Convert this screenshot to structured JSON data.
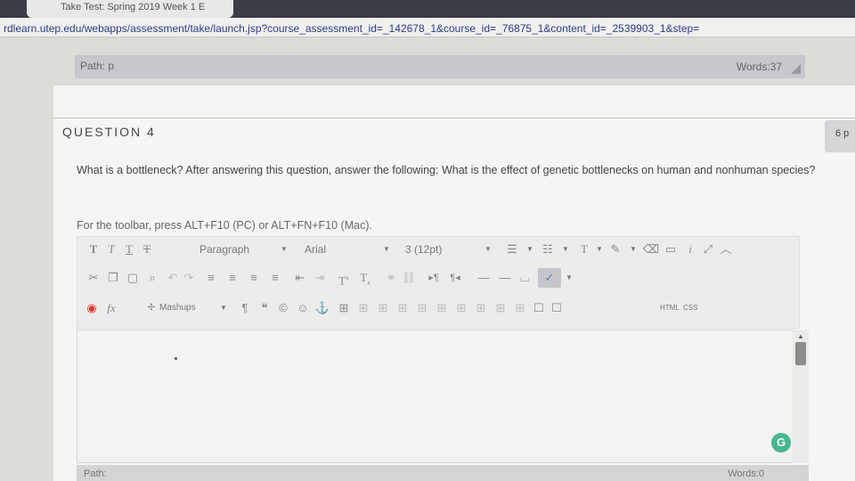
{
  "browser": {
    "tab_title": "Take Test: Spring 2019 Week 1 E",
    "url": "rdlearn.utep.edu/webapps/assessment/take/launch.jsp?course_assessment_id=_142678_1&course_id=_76875_1&content_id=_2539903_1&step="
  },
  "prev_editor": {
    "path_label": "Path: p",
    "word_count": "Words:37"
  },
  "question": {
    "title": "QUESTION 4",
    "points": "6 p",
    "text": "What is a bottleneck? After answering this question, answer the following: What is the effect of genetic bottlenecks on human and nonhuman species?",
    "toolbar_hint": "For the toolbar, press ALT+F10 (PC) or ALT+FN+F10 (Mac)."
  },
  "toolbar": {
    "paragraph": "Paragraph",
    "font": "Arial",
    "size": "3 (12pt)",
    "mashups": "Mashups",
    "html": "HTML",
    "css": "CSS",
    "superscript": "T",
    "subscript": "T",
    "spellcheck_glyph": "✓"
  },
  "editor": {
    "word_count": "Words:0",
    "path_label": "Path:",
    "grammarly": "G"
  },
  "colors": {
    "accent_check": "#4a7fb5",
    "grammarly": "#45b78e",
    "record": "#e0312b"
  }
}
